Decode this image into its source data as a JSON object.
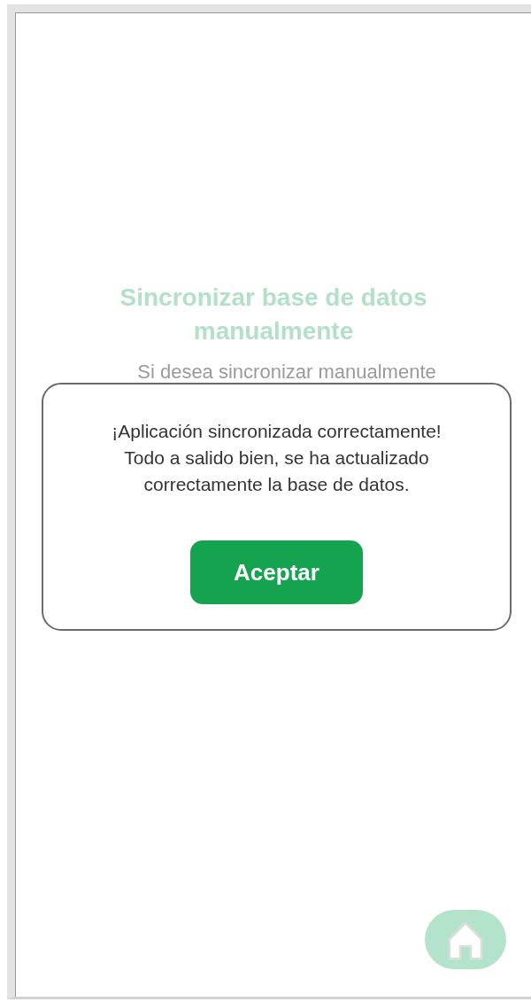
{
  "screen": {
    "title": "Sincronizar base de datos manualmente",
    "subtitle": "Si desea sincronizar manualmente"
  },
  "dialog": {
    "title": "¡Aplicación sincronizada correctamente!",
    "message": "Todo a salido bien, se ha actualizado correctamente la base de datos.",
    "button": "Aceptar"
  }
}
